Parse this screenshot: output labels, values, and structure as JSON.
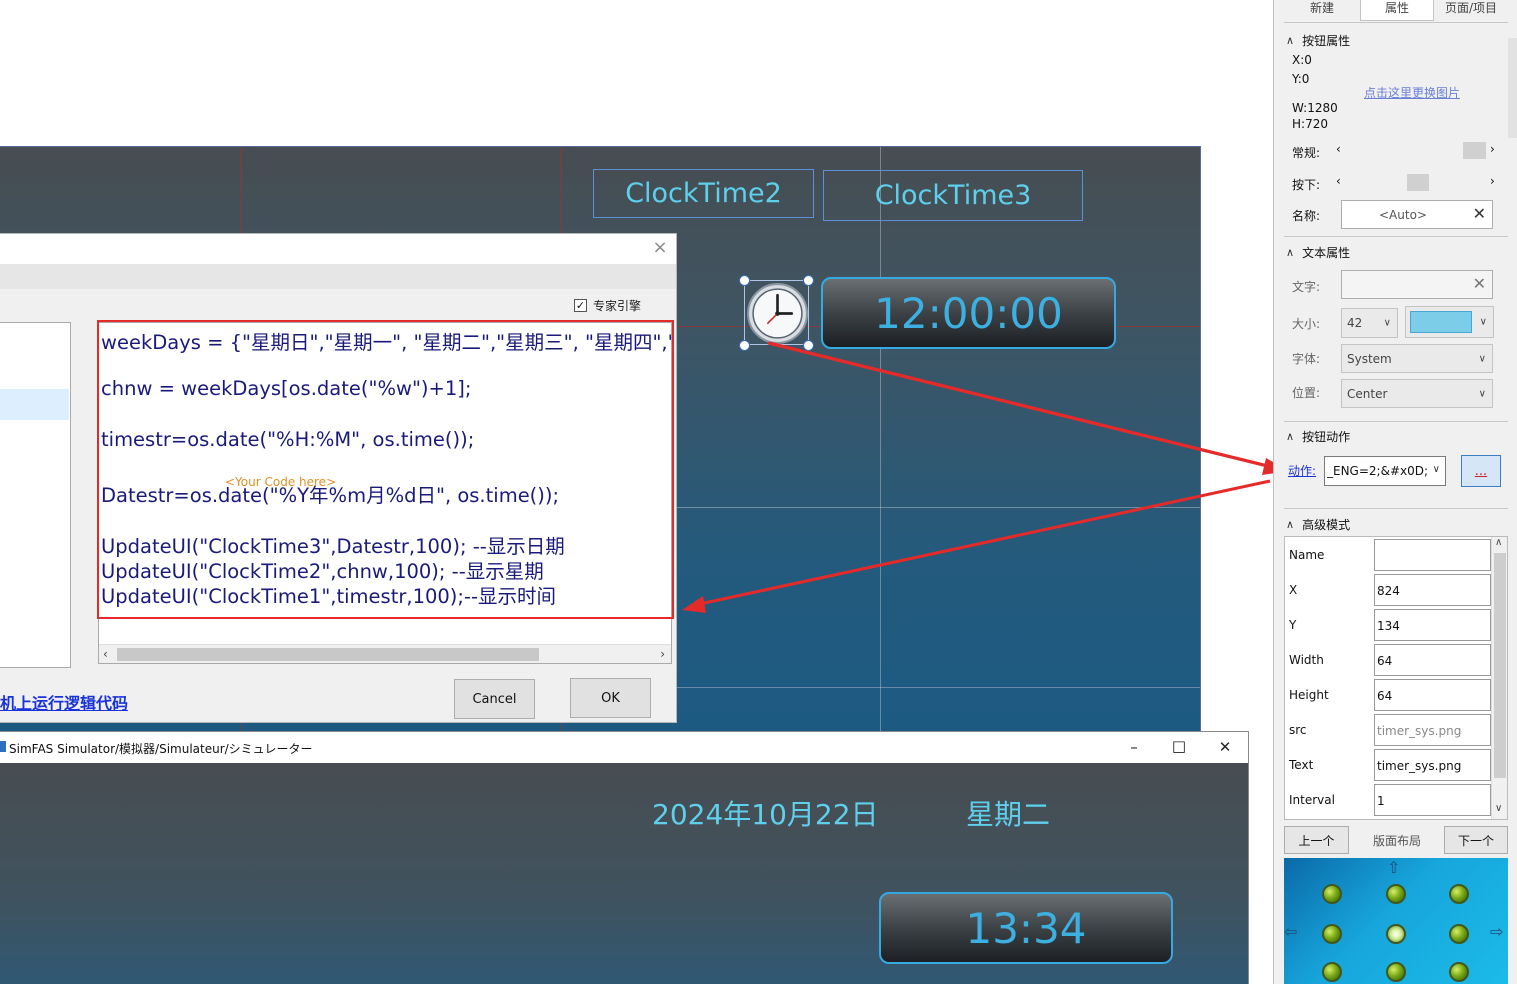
{
  "canvas": {
    "controls": {
      "clock_time2": "ClockTime2",
      "clock_time3": "ClockTime3",
      "clock_display": "12:00:00"
    }
  },
  "code_dialog": {
    "close_glyph": "×",
    "expert_mode_label": "专家引擎",
    "code_placeholder": "<Your Code here>",
    "code_lines": [
      "weekDays = {\"星期日\",\"星期一\", \"星期二\",\"星期三\", \"星期四\",\"星",
      "chnw = weekDays[os.date(\"%w\")+1];",
      "timestr=os.date(\"%H:%M\", os.time());",
      "Datestr=os.date(\"%Y年%m月%d日\", os.time());",
      "UpdateUI(\"ClockTime3\",Datestr,100); --显示日期",
      "UpdateUI(\"ClockTime2\",chnw,100); --显示星期",
      "UpdateUI(\"ClockTime1\",timestr,100);--显示时间"
    ],
    "run_link": "机上运行逻辑代码",
    "cancel_label": "Cancel",
    "ok_label": "OK"
  },
  "simulator": {
    "title": "SimFAS Simulator/模拟器/Simulateur/シミュレーター",
    "date_text": "2024年10月22日",
    "weekday_text": "星期二",
    "time_text": "13:34"
  },
  "properties_panel": {
    "tabs": [
      "新建",
      "属性",
      "页面/项目"
    ],
    "button_props": {
      "header": "按钮属性",
      "x": "X:0",
      "y": "Y:0",
      "w": "W:1280",
      "h": "H:720",
      "change_image_link": "点击这里更换图片",
      "normal_label": "常规:",
      "pressed_label": "按下:",
      "name_label": "名称:",
      "name_value": "<Auto>"
    },
    "text_props": {
      "header": "文本属性",
      "text_label": "文字:",
      "size_label": "大小:",
      "size_value": "42",
      "font_label": "字体:",
      "font_value": "System",
      "position_label": "位置:",
      "position_value": "Center"
    },
    "action": {
      "header": "按钮动作",
      "action_label": "动作:",
      "action_value": "_ENG=2;&#x0D;&",
      "more_label": "..."
    },
    "advanced": {
      "header": "高级模式",
      "rows": [
        {
          "key": "Name",
          "value": ""
        },
        {
          "key": "X",
          "value": "824"
        },
        {
          "key": "Y",
          "value": "134"
        },
        {
          "key": "Width",
          "value": "64"
        },
        {
          "key": "Height",
          "value": "64"
        },
        {
          "key": "src",
          "value": "timer_sys.png"
        },
        {
          "key": "Text",
          "value": "timer_sys.png"
        },
        {
          "key": "Interval",
          "value": "1"
        }
      ]
    },
    "nav": {
      "prev": "上一个",
      "layout": "版面布局",
      "next": "下一个"
    }
  },
  "colors": {
    "annotation_red": "#e52a2a",
    "cyan_text": "#5fd0ec",
    "link_blue": "#1a33d8"
  }
}
